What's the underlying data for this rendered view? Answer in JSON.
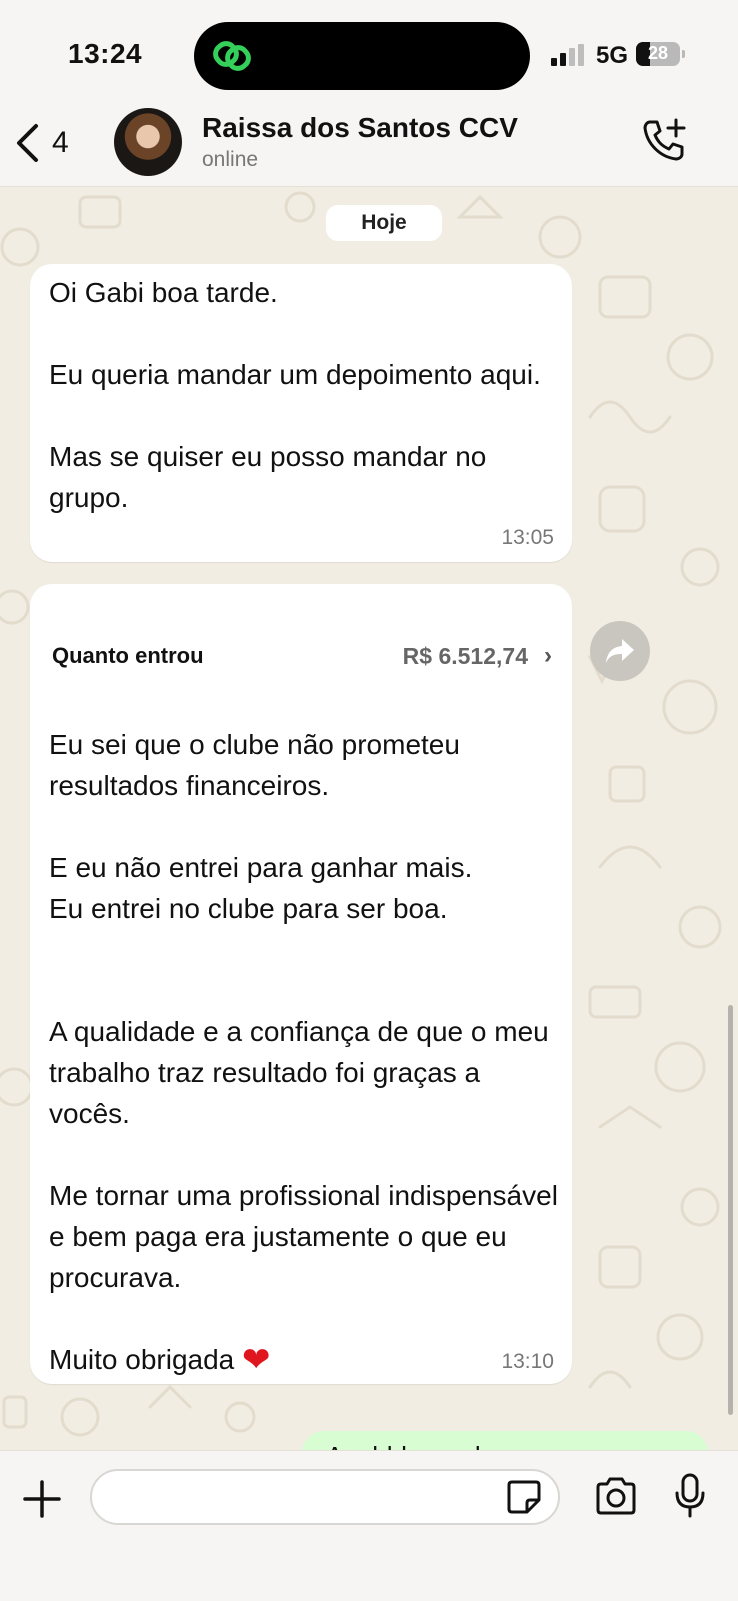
{
  "status_bar": {
    "time": "13:24",
    "network": "5G",
    "battery": "28",
    "battery_level_percent": 28
  },
  "header": {
    "back_count": "4",
    "contact_name": "Raissa dos Santos CCV",
    "contact_status": "online",
    "icons": [
      "chevron-left-icon",
      "add-call-icon"
    ]
  },
  "chat": {
    "date_chip": "Hoje",
    "messages": [
      {
        "text": "Oi Gabi boa tarde.\n\nEu queria mandar um depoimento aqui.\n\nMas se quiser eu posso mandar no grupo.",
        "time": "13:05"
      },
      {
        "payment_label": "Quanto entrou",
        "payment_value": "R$ 6.512,74",
        "text": "Eu sei que o clube não prometeu resultados financeiros.\n\nE eu não entrei para ganhar mais.\nEu entrei no clube para ser boa.\n\n\nA qualidade e a confiança de que o meu trabalho traz resultado foi graças a vocês.\n\nMe tornar uma profissional indispensável e bem paga era justamente o que eu procurava.\n\nMuito obrigada ",
        "emoji": "❤",
        "time": "13:10"
      }
    ],
    "outgoing_partial": "Aaahhh parabens"
  },
  "input_bar": {
    "placeholder": "",
    "icons": [
      "plus-icon",
      "sticker-icon",
      "camera-icon",
      "microphone-icon"
    ]
  },
  "colors": {
    "chat_background": "#f1ede3",
    "incoming_bubble": "#ffffff",
    "outgoing_bubble": "#d9fdd3",
    "heart": "#e0161f"
  }
}
